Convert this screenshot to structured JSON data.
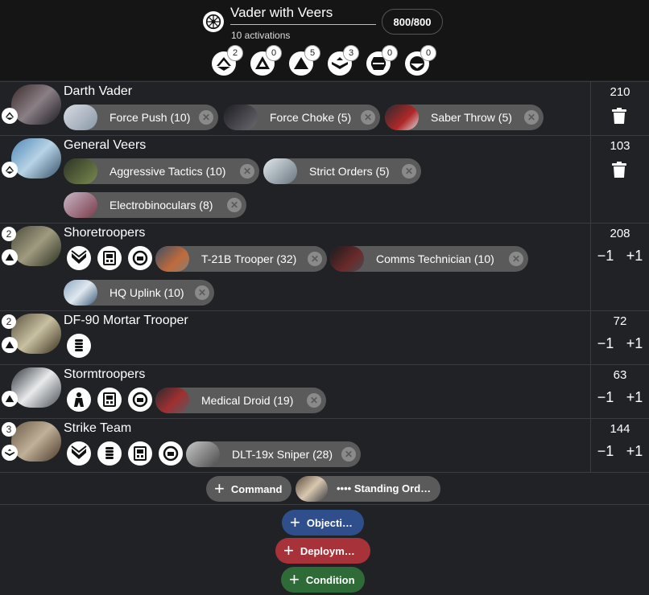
{
  "header": {
    "faction_icon": "empire-icon",
    "army_name": "Vader with Veers",
    "activations": "10 activations",
    "points": "800/800",
    "ranks": [
      {
        "icon": "commander-icon",
        "count": "2"
      },
      {
        "icon": "operative-icon",
        "count": "0"
      },
      {
        "icon": "corps-icon",
        "count": "5"
      },
      {
        "icon": "special-forces-icon",
        "count": "3"
      },
      {
        "icon": "support-icon",
        "count": "0"
      },
      {
        "icon": "heavy-icon",
        "count": "0"
      }
    ]
  },
  "units": [
    {
      "name": "Darth Vader",
      "points": "210",
      "count": "",
      "rank_icon": "commander-icon",
      "action": "delete",
      "slots": [],
      "upgrades": [
        "Force Push (10)",
        "Force Choke (5)",
        "Saber Throw (5)"
      ]
    },
    {
      "name": "General Veers",
      "points": "103",
      "count": "",
      "rank_icon": "commander-icon",
      "action": "delete",
      "slots": [],
      "upgrades": [
        "Aggressive Tactics (10)",
        "Strict Orders (5)",
        "Electrobinoculars (8)"
      ]
    },
    {
      "name": "Shoretroopers",
      "points": "208",
      "count": "2",
      "rank_icon": "corps-icon",
      "action": "stepper",
      "slots": [
        "training-icon",
        "comms-icon",
        "gear-icon"
      ],
      "upgrades": [
        "T-21B Trooper (32)",
        "Comms Technician (10)",
        "HQ Uplink (10)"
      ]
    },
    {
      "name": "DF-90 Mortar Trooper",
      "points": "72",
      "count": "2",
      "rank_icon": "corps-icon",
      "action": "stepper",
      "slots": [
        "grenades-icon"
      ],
      "upgrades": []
    },
    {
      "name": "Stormtroopers",
      "points": "63",
      "count": "",
      "rank_icon": "corps-icon",
      "action": "stepper",
      "slots": [
        "personnel-icon",
        "comms-icon",
        "gear-icon"
      ],
      "upgrades": [
        "Medical Droid (19)"
      ]
    },
    {
      "name": "Strike Team",
      "points": "144",
      "count": "3",
      "rank_icon": "special-forces-icon",
      "action": "stepper",
      "slots": [
        "training-icon",
        "grenades-icon",
        "comms-icon",
        "gear-icon"
      ],
      "upgrades": [
        "DLT-19x Sniper (28)"
      ]
    }
  ],
  "stepper": {
    "minus": "−1",
    "plus": "+1"
  },
  "bottom": {
    "command": "Command",
    "standing_orders": "•••• Standing Ord…",
    "objective": "Objecti…",
    "deployment": "Deploym…",
    "condition": "Condition"
  },
  "colors": {
    "background": "#202226",
    "header": "#151515",
    "pill": "#5a5a5a",
    "objective": "#2f4f8c",
    "deployment": "#a8323a",
    "condition": "#2f6b36"
  }
}
